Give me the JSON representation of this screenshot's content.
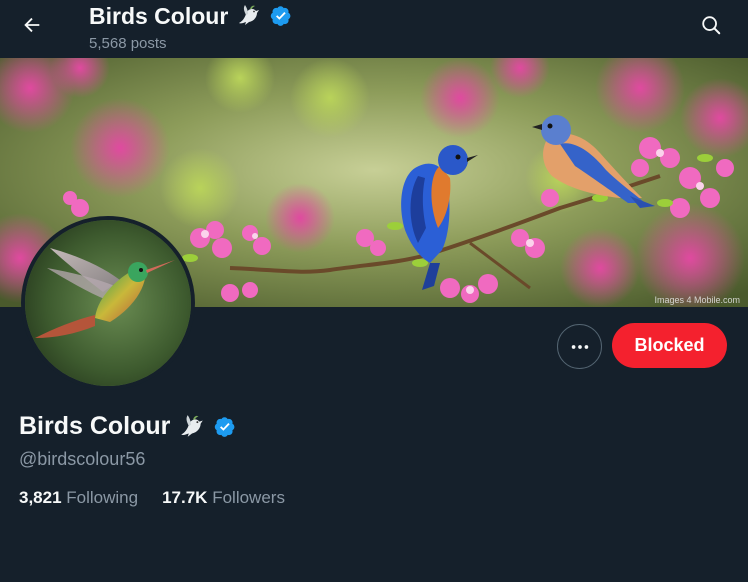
{
  "header": {
    "title": "Birds Colour",
    "posts_count": "5,568 posts"
  },
  "profile": {
    "display_name": "Birds Colour",
    "handle": "@birdscolour56",
    "following_count": "3,821",
    "following_label": "Following",
    "followers_count": "17.7K",
    "followers_label": "Followers"
  },
  "actions": {
    "blocked_label": "Blocked"
  },
  "banner": {
    "watermark": "Images 4 Mobile.com"
  },
  "icons": {
    "back": "arrow-left-icon",
    "search": "search-icon",
    "more": "more-horizontal-icon",
    "verified": "verified-badge-icon",
    "dove": "dove-emoji-icon"
  },
  "colors": {
    "background": "#15202b",
    "blocked_button": "#f4212e",
    "verified_badge": "#1d9bf0",
    "secondary_text": "#8b98a5"
  }
}
